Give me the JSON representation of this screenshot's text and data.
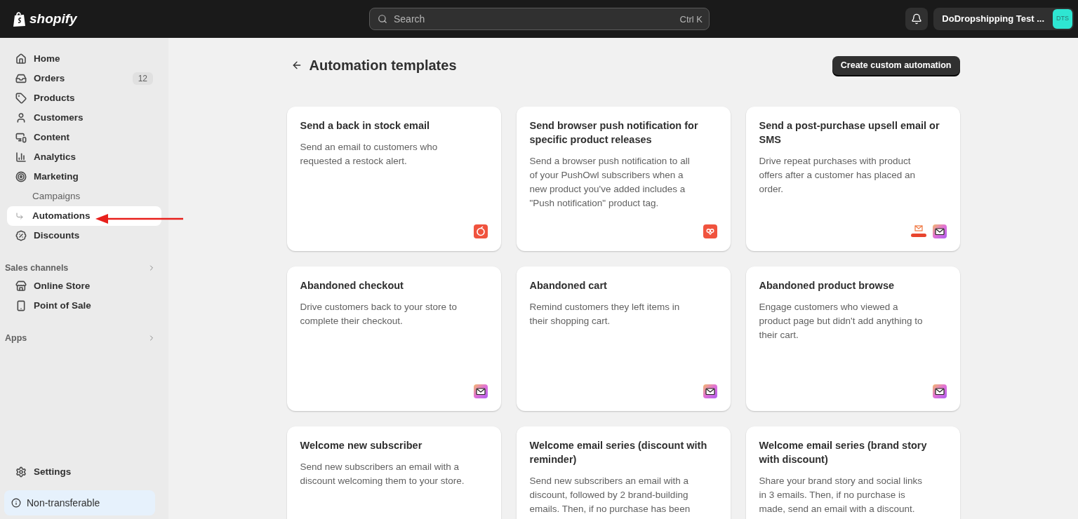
{
  "topbar": {
    "logo": "shopify",
    "search": {
      "placeholder": "Search",
      "shortcut": "Ctrl K"
    },
    "store": {
      "name": "DoDropshipping Test ...",
      "initials": "DTS"
    }
  },
  "sidebar": {
    "items": [
      {
        "label": "Home",
        "kind": "home",
        "selected": false
      },
      {
        "label": "Orders",
        "kind": "orders",
        "badge": "12",
        "selected": false
      },
      {
        "label": "Products",
        "kind": "products",
        "selected": false
      },
      {
        "label": "Customers",
        "kind": "customers",
        "selected": false
      },
      {
        "label": "Content",
        "kind": "content",
        "selected": false
      },
      {
        "label": "Analytics",
        "kind": "analytics",
        "selected": false
      },
      {
        "label": "Marketing",
        "kind": "marketing",
        "selected": false,
        "children": [
          {
            "label": "Campaigns",
            "selected": false
          },
          {
            "label": "Automations",
            "selected": true
          }
        ]
      },
      {
        "label": "Discounts",
        "kind": "discounts",
        "selected": false
      }
    ],
    "sections": [
      {
        "title": "Sales channels",
        "items": [
          {
            "label": "Online Store",
            "kind": "store",
            "selected": false
          },
          {
            "label": "Point of Sale",
            "kind": "pos",
            "selected": false
          }
        ]
      },
      {
        "title": "Apps"
      }
    ],
    "settings": "Settings",
    "notice": "Non-transferable"
  },
  "page": {
    "title": "Automation templates",
    "action": "Create custom automation",
    "cards": [
      {
        "title": "Send a back in stock email",
        "description": "Send an email to customers who requested a restock alert.",
        "apps": [
          {
            "kind": "restock"
          }
        ]
      },
      {
        "title": "Send browser push notification for specific product releases",
        "description": "Send a browser push notification to all of your PushOwl subscribers when a new product you've added includes a \"Push notification\" product tag.",
        "apps": [
          {
            "kind": "pushowl"
          }
        ]
      },
      {
        "title": "Send a post-purchase upsell email or SMS",
        "description": "Drive repeat purchases with product offers after a customer has placed an order.",
        "apps": [
          {
            "kind": "upsell"
          },
          {
            "kind": "email"
          }
        ]
      },
      {
        "title": "Abandoned checkout",
        "description": "Drive customers back to your store to complete their checkout.",
        "apps": [
          {
            "kind": "email"
          }
        ]
      },
      {
        "title": "Abandoned cart",
        "description": "Remind customers they left items in their shopping cart.",
        "apps": [
          {
            "kind": "email"
          }
        ]
      },
      {
        "title": "Abandoned product browse",
        "description": "Engage customers who viewed a product page but didn't add anything to their cart.",
        "apps": [
          {
            "kind": "email"
          }
        ]
      },
      {
        "title": "Welcome new subscriber",
        "description": "Send new subscribers an email with a discount welcoming them to your store."
      },
      {
        "title": "Welcome email series (discount with reminder)",
        "description": "Send new subscribers an email with a discount, followed by 2 brand-building emails. Then, if no purchase has been"
      },
      {
        "title": "Welcome email series (brand story with discount)",
        "description": "Share your brand story and social links in 3 emails. Then, if no purchase is made, send an email with a discount."
      }
    ]
  }
}
